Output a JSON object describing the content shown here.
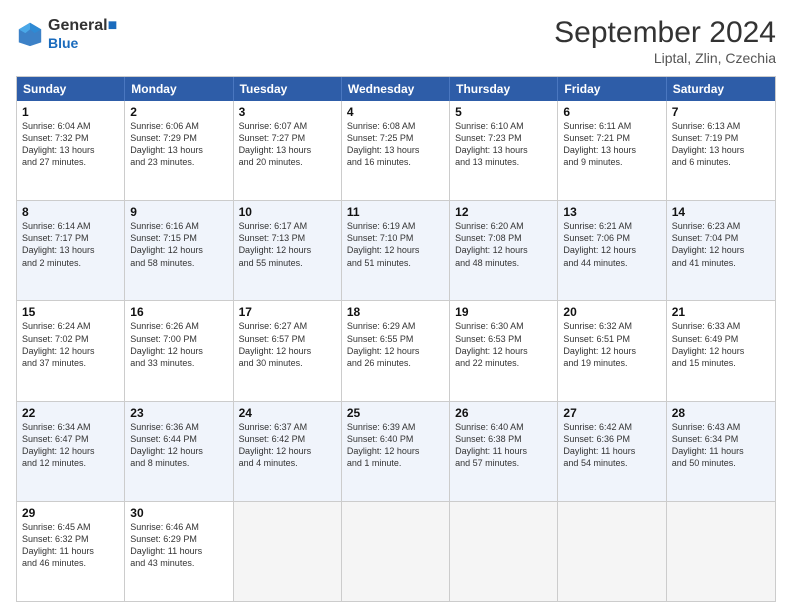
{
  "header": {
    "logo_line1": "General",
    "logo_line2": "Blue",
    "month_title": "September 2024",
    "subtitle": "Liptal, Zlin, Czechia"
  },
  "days_of_week": [
    "Sunday",
    "Monday",
    "Tuesday",
    "Wednesday",
    "Thursday",
    "Friday",
    "Saturday"
  ],
  "rows": [
    [
      {
        "day": "",
        "info": ""
      },
      {
        "day": "2",
        "info": "Sunrise: 6:06 AM\nSunset: 7:29 PM\nDaylight: 13 hours\nand 23 minutes."
      },
      {
        "day": "3",
        "info": "Sunrise: 6:07 AM\nSunset: 7:27 PM\nDaylight: 13 hours\nand 20 minutes."
      },
      {
        "day": "4",
        "info": "Sunrise: 6:08 AM\nSunset: 7:25 PM\nDaylight: 13 hours\nand 16 minutes."
      },
      {
        "day": "5",
        "info": "Sunrise: 6:10 AM\nSunset: 7:23 PM\nDaylight: 13 hours\nand 13 minutes."
      },
      {
        "day": "6",
        "info": "Sunrise: 6:11 AM\nSunset: 7:21 PM\nDaylight: 13 hours\nand 9 minutes."
      },
      {
        "day": "7",
        "info": "Sunrise: 6:13 AM\nSunset: 7:19 PM\nDaylight: 13 hours\nand 6 minutes."
      }
    ],
    [
      {
        "day": "8",
        "info": "Sunrise: 6:14 AM\nSunset: 7:17 PM\nDaylight: 13 hours\nand 2 minutes."
      },
      {
        "day": "9",
        "info": "Sunrise: 6:16 AM\nSunset: 7:15 PM\nDaylight: 12 hours\nand 58 minutes."
      },
      {
        "day": "10",
        "info": "Sunrise: 6:17 AM\nSunset: 7:13 PM\nDaylight: 12 hours\nand 55 minutes."
      },
      {
        "day": "11",
        "info": "Sunrise: 6:19 AM\nSunset: 7:10 PM\nDaylight: 12 hours\nand 51 minutes."
      },
      {
        "day": "12",
        "info": "Sunrise: 6:20 AM\nSunset: 7:08 PM\nDaylight: 12 hours\nand 48 minutes."
      },
      {
        "day": "13",
        "info": "Sunrise: 6:21 AM\nSunset: 7:06 PM\nDaylight: 12 hours\nand 44 minutes."
      },
      {
        "day": "14",
        "info": "Sunrise: 6:23 AM\nSunset: 7:04 PM\nDaylight: 12 hours\nand 41 minutes."
      }
    ],
    [
      {
        "day": "15",
        "info": "Sunrise: 6:24 AM\nSunset: 7:02 PM\nDaylight: 12 hours\nand 37 minutes."
      },
      {
        "day": "16",
        "info": "Sunrise: 6:26 AM\nSunset: 7:00 PM\nDaylight: 12 hours\nand 33 minutes."
      },
      {
        "day": "17",
        "info": "Sunrise: 6:27 AM\nSunset: 6:57 PM\nDaylight: 12 hours\nand 30 minutes."
      },
      {
        "day": "18",
        "info": "Sunrise: 6:29 AM\nSunset: 6:55 PM\nDaylight: 12 hours\nand 26 minutes."
      },
      {
        "day": "19",
        "info": "Sunrise: 6:30 AM\nSunset: 6:53 PM\nDaylight: 12 hours\nand 22 minutes."
      },
      {
        "day": "20",
        "info": "Sunrise: 6:32 AM\nSunset: 6:51 PM\nDaylight: 12 hours\nand 19 minutes."
      },
      {
        "day": "21",
        "info": "Sunrise: 6:33 AM\nSunset: 6:49 PM\nDaylight: 12 hours\nand 15 minutes."
      }
    ],
    [
      {
        "day": "22",
        "info": "Sunrise: 6:34 AM\nSunset: 6:47 PM\nDaylight: 12 hours\nand 12 minutes."
      },
      {
        "day": "23",
        "info": "Sunrise: 6:36 AM\nSunset: 6:44 PM\nDaylight: 12 hours\nand 8 minutes."
      },
      {
        "day": "24",
        "info": "Sunrise: 6:37 AM\nSunset: 6:42 PM\nDaylight: 12 hours\nand 4 minutes."
      },
      {
        "day": "25",
        "info": "Sunrise: 6:39 AM\nSunset: 6:40 PM\nDaylight: 12 hours\nand 1 minute."
      },
      {
        "day": "26",
        "info": "Sunrise: 6:40 AM\nSunset: 6:38 PM\nDaylight: 11 hours\nand 57 minutes."
      },
      {
        "day": "27",
        "info": "Sunrise: 6:42 AM\nSunset: 6:36 PM\nDaylight: 11 hours\nand 54 minutes."
      },
      {
        "day": "28",
        "info": "Sunrise: 6:43 AM\nSunset: 6:34 PM\nDaylight: 11 hours\nand 50 minutes."
      }
    ],
    [
      {
        "day": "29",
        "info": "Sunrise: 6:45 AM\nSunset: 6:32 PM\nDaylight: 11 hours\nand 46 minutes."
      },
      {
        "day": "30",
        "info": "Sunrise: 6:46 AM\nSunset: 6:29 PM\nDaylight: 11 hours\nand 43 minutes."
      },
      {
        "day": "",
        "info": ""
      },
      {
        "day": "",
        "info": ""
      },
      {
        "day": "",
        "info": ""
      },
      {
        "day": "",
        "info": ""
      },
      {
        "day": "",
        "info": ""
      }
    ]
  ],
  "row0_day1": {
    "day": "1",
    "info": "Sunrise: 6:04 AM\nSunset: 7:32 PM\nDaylight: 13 hours\nand 27 minutes."
  }
}
